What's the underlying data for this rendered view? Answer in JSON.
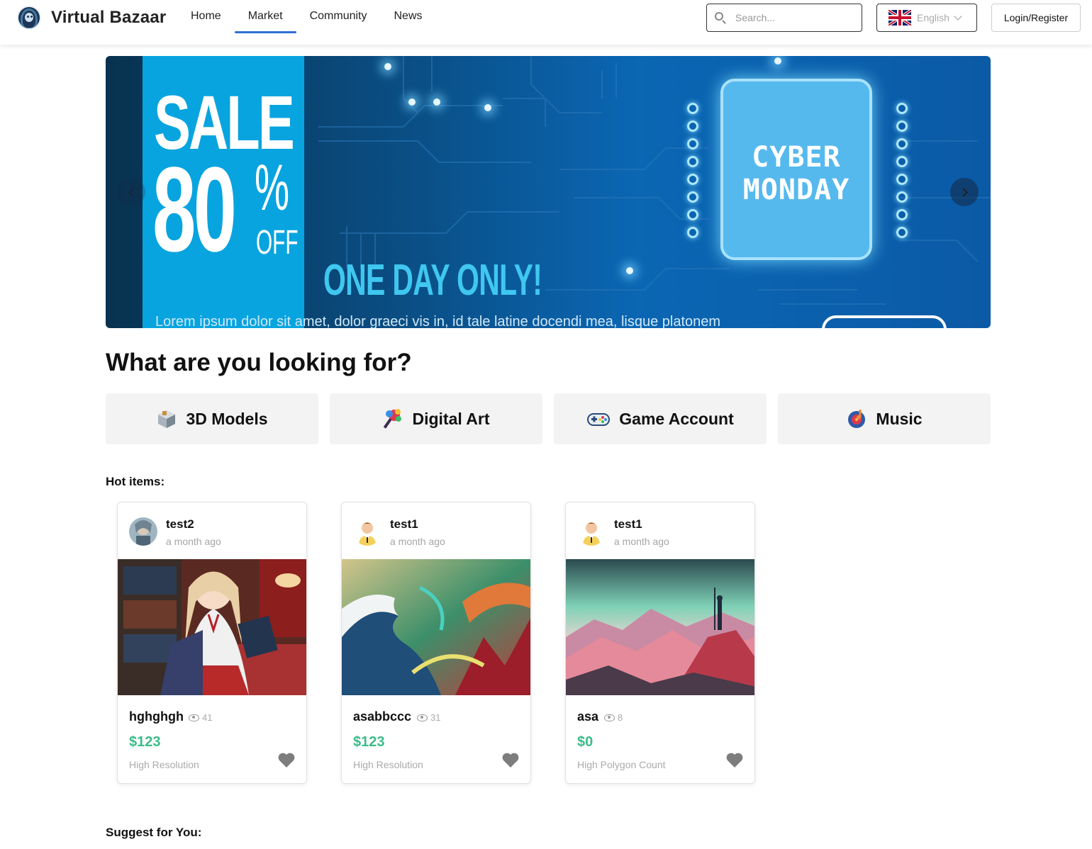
{
  "header": {
    "brand_name": "Virtual Bazaar",
    "nav": [
      {
        "label": "Home",
        "active": false
      },
      {
        "label": "Market",
        "active": true
      },
      {
        "label": "Community",
        "active": false
      },
      {
        "label": "News",
        "active": false
      }
    ],
    "search_placeholder": "Search...",
    "language": "English",
    "login_label": "Login/Register",
    "accent_color": "#2f6fd6"
  },
  "banner": {
    "sale_word": "SALE",
    "sale_number": "80",
    "sale_percent": "%",
    "sale_off": "OFF",
    "one_day": "ONE DAY ONLY!",
    "chip_line1": "CYBER",
    "chip_line2": "MONDAY",
    "lorem": "Lorem ipsum dolor sit amet, dolor graeci vis in, id tale latine docendi mea, lisque platonem"
  },
  "section_title": "What are you looking for?",
  "categories": [
    {
      "label": "3D Models",
      "icon": "cube-icon"
    },
    {
      "label": "Digital Art",
      "icon": "palette-icon"
    },
    {
      "label": "Game Account",
      "icon": "gamepad-icon"
    },
    {
      "label": "Music",
      "icon": "music-icon"
    }
  ],
  "hot_items_title": "Hot items:",
  "hot_items": [
    {
      "seller": "test2",
      "time": "a month ago",
      "name": "hghghgh",
      "views": "41",
      "price": "$123",
      "tag": "High Resolution"
    },
    {
      "seller": "test1",
      "time": "a month ago",
      "name": "asabbccc",
      "views": "31",
      "price": "$123",
      "tag": "High Resolution"
    },
    {
      "seller": "test1",
      "time": "a month ago",
      "name": "asa",
      "views": "8",
      "price": "$0",
      "tag": "High Polygon Count"
    }
  ],
  "suggest_title": "Suggest for You:",
  "colors": {
    "price": "#3dbb8b",
    "heart": "#7d7d7d",
    "category_bg": "#f3f3f3"
  }
}
